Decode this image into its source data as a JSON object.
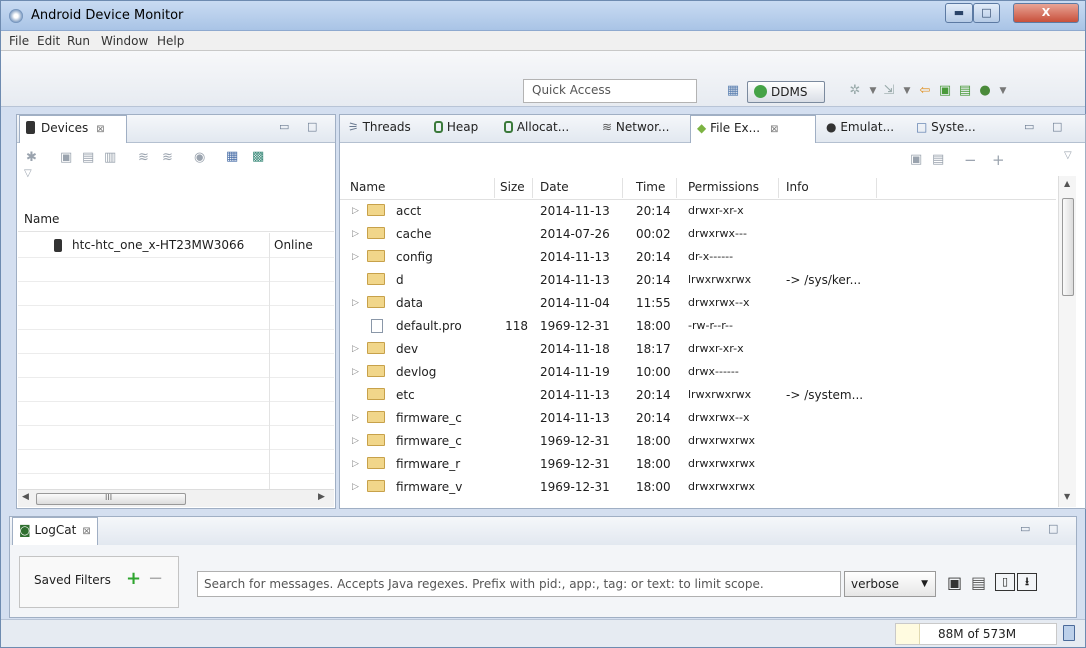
{
  "window": {
    "title": "Android Device Monitor",
    "minimize": "▬",
    "maximize": "□",
    "close": "X"
  },
  "menu": [
    "File",
    "Edit",
    "Run",
    "Window",
    "Help"
  ],
  "toolbar": {
    "quick_access": "Quick Access",
    "ddms_label": "DDMS"
  },
  "devices_view": {
    "tab_label": "Devices",
    "column_name": "Name",
    "device": {
      "name": "htc-htc_one_x-HT23MW3066",
      "status": "Online"
    },
    "hscroll_marker": "III"
  },
  "tabs": [
    "Threads",
    "Heap",
    "Allocat...",
    "Networ...",
    "File Ex...",
    "Emulat...",
    "Syste..."
  ],
  "active_tab": "File Ex...",
  "file_explorer": {
    "columns": [
      "Name",
      "Size",
      "Date",
      "Time",
      "Permissions",
      "Info"
    ],
    "rows": [
      {
        "expand": "▷",
        "type": "folder",
        "name": "acct",
        "size": "",
        "date": "2014-11-13",
        "time": "20:14",
        "perm": "drwxr-xr-x",
        "info": ""
      },
      {
        "expand": "▷",
        "type": "folder",
        "name": "cache",
        "size": "",
        "date": "2014-07-26",
        "time": "00:02",
        "perm": "drwxrwx---",
        "info": ""
      },
      {
        "expand": "▷",
        "type": "folder",
        "name": "config",
        "size": "",
        "date": "2014-11-13",
        "time": "20:14",
        "perm": "dr-x------",
        "info": ""
      },
      {
        "expand": "",
        "type": "folder",
        "name": "d",
        "size": "",
        "date": "2014-11-13",
        "time": "20:14",
        "perm": "lrwxrwxrwx",
        "info": "-> /sys/ker..."
      },
      {
        "expand": "▷",
        "type": "folder",
        "name": "data",
        "size": "",
        "date": "2014-11-04",
        "time": "11:55",
        "perm": "drwxrwx--x",
        "info": ""
      },
      {
        "expand": "",
        "type": "file",
        "name": "default.pro",
        "size": "118",
        "date": "1969-12-31",
        "time": "18:00",
        "perm": "-rw-r--r--",
        "info": ""
      },
      {
        "expand": "▷",
        "type": "folder",
        "name": "dev",
        "size": "",
        "date": "2014-11-18",
        "time": "18:17",
        "perm": "drwxr-xr-x",
        "info": ""
      },
      {
        "expand": "▷",
        "type": "folder",
        "name": "devlog",
        "size": "",
        "date": "2014-11-19",
        "time": "10:00",
        "perm": "drwx------",
        "info": ""
      },
      {
        "expand": "",
        "type": "folder",
        "name": "etc",
        "size": "",
        "date": "2014-11-13",
        "time": "20:14",
        "perm": "lrwxrwxrwx",
        "info": "-> /system..."
      },
      {
        "expand": "▷",
        "type": "folder",
        "name": "firmware_c",
        "size": "",
        "date": "2014-11-13",
        "time": "20:14",
        "perm": "drwxrwx--x",
        "info": ""
      },
      {
        "expand": "▷",
        "type": "folder",
        "name": "firmware_c",
        "size": "",
        "date": "1969-12-31",
        "time": "18:00",
        "perm": "drwxrwxrwx",
        "info": ""
      },
      {
        "expand": "▷",
        "type": "folder",
        "name": "firmware_r",
        "size": "",
        "date": "1969-12-31",
        "time": "18:00",
        "perm": "drwxrwxrwx",
        "info": ""
      },
      {
        "expand": "▷",
        "type": "folder",
        "name": "firmware_v",
        "size": "",
        "date": "1969-12-31",
        "time": "18:00",
        "perm": "drwxrwxrwx",
        "info": ""
      }
    ]
  },
  "logcat": {
    "tab_label": "LogCat",
    "saved_filters": "Saved Filters",
    "search_placeholder": "Search for messages. Accepts Java regexes. Prefix with pid:, app:, tag: or text: to limit scope.",
    "level": "verbose"
  },
  "status": {
    "memory": "88M of 573M",
    "memory_used_fraction": 0.15
  },
  "colors": {
    "folder": "#f1d68a",
    "ddms": "#45a346",
    "add": "#2ea52e",
    "delete": "#d23a3a"
  }
}
